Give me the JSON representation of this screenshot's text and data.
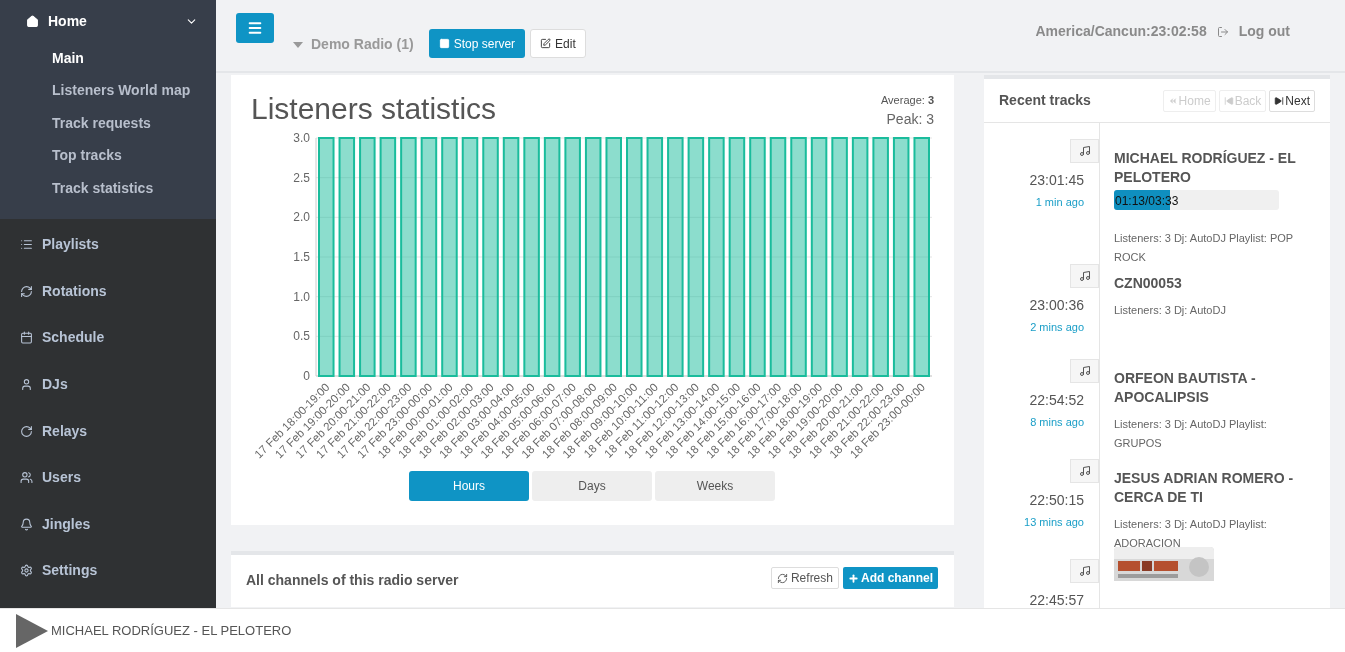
{
  "sidebar": {
    "home": {
      "label": "Home",
      "expanded": true,
      "children": [
        {
          "label": "Main",
          "selected": true
        },
        {
          "label": "Listeners World map",
          "selected": false
        },
        {
          "label": "Track requests",
          "selected": false
        },
        {
          "label": "Top tracks",
          "selected": false
        },
        {
          "label": "Track statistics",
          "selected": false
        }
      ]
    },
    "items": [
      {
        "label": "Playlists"
      },
      {
        "label": "Rotations"
      },
      {
        "label": "Schedule"
      },
      {
        "label": "DJs"
      },
      {
        "label": "Relays"
      },
      {
        "label": "Users"
      },
      {
        "label": "Jingles"
      },
      {
        "label": "Settings"
      }
    ]
  },
  "topbar": {
    "server": "Demo Radio (1)",
    "stop_button": "Stop server",
    "edit_button": "Edit",
    "clock": "America/Cancun:23:02:58",
    "logout": "Log out"
  },
  "stats": {
    "title": "Listeners statistics",
    "average_label": "Average:",
    "average": "3",
    "peak": "Peak: 3",
    "chart_data": {
      "type": "bar",
      "categories": [
        "17 Feb 18:00-19:00",
        "17 Feb 19:00-20:00",
        "17 Feb 20:00-21:00",
        "17 Feb 21:00-22:00",
        "17 Feb 22:00-23:00",
        "17 Feb 23:00-00:00",
        "18 Feb 00:00-01:00",
        "18 Feb 01:00-02:00",
        "18 Feb 02:00-03:00",
        "18 Feb 03:00-04:00",
        "18 Feb 04:00-05:00",
        "18 Feb 05:00-06:00",
        "18 Feb 06:00-07:00",
        "18 Feb 07:00-08:00",
        "18 Feb 08:00-09:00",
        "18 Feb 09:00-10:00",
        "18 Feb 10:00-11:00",
        "18 Feb 11:00-12:00",
        "18 Feb 12:00-13:00",
        "18 Feb 13:00-14:00",
        "18 Feb 14:00-15:00",
        "18 Feb 15:00-16:00",
        "18 Feb 16:00-17:00",
        "18 Feb 17:00-18:00",
        "18 Feb 18:00-19:00",
        "18 Feb 19:00-20:00",
        "18 Feb 20:00-21:00",
        "18 Feb 21:00-22:00",
        "18 Feb 22:00-23:00",
        "18 Feb 23:00-00:00"
      ],
      "grid": true,
      "series": [
        {
          "color": "#1abc9c",
          "values": [
            3,
            3,
            3,
            3,
            3,
            3,
            3,
            3,
            3,
            3,
            3,
            3,
            3,
            3,
            3,
            3,
            3,
            3,
            3,
            3,
            3,
            3,
            3,
            3,
            3,
            3,
            3,
            3,
            3,
            3
          ]
        }
      ],
      "ylim": [
        0,
        3
      ],
      "yticks": [
        {
          "value": 0,
          "label": "0"
        },
        {
          "value": 0.5,
          "label": "0.5"
        },
        {
          "value": 1,
          "label": "1.0"
        },
        {
          "value": 1.5,
          "label": "1.5"
        },
        {
          "value": 2,
          "label": "2.0"
        },
        {
          "value": 2.5,
          "label": "2.5"
        },
        {
          "value": 3,
          "label": "3.0"
        }
      ]
    },
    "periods": [
      {
        "label": "Hours",
        "selected": true
      },
      {
        "label": "Days",
        "selected": false
      },
      {
        "label": "Weeks",
        "selected": false
      }
    ]
  },
  "channels": {
    "title": "All channels of this radio server",
    "refresh": "Refresh",
    "add": "Add channel"
  },
  "recent": {
    "title": "Recent tracks",
    "nav": [
      {
        "label": "Home",
        "disabled": true
      },
      {
        "label": "Back",
        "disabled": true
      },
      {
        "label": "Next",
        "disabled": false
      }
    ],
    "tracks": [
      {
        "time": "23:01:45",
        "ago": "1 min ago",
        "title": "MICHAEL RODRÍGUEZ - EL PELOTERO",
        "progress": {
          "text": "01:13/03:33",
          "level": 0.34
        },
        "meta": "Listeners: 3 Dj: AutoDJ Playlist: POP ROCK"
      },
      {
        "time": "23:00:36",
        "ago": "2 mins ago",
        "title": "CZN00053",
        "meta": "Listeners: 3 Dj: AutoDJ"
      },
      {
        "time": "22:54:52",
        "ago": "8 mins ago",
        "title": "ORFEON BAUTISTA - APOCALIPSIS",
        "meta": "Listeners: 3 Dj: AutoDJ Playlist: GRUPOS"
      },
      {
        "time": "22:50:15",
        "ago": "13 mins ago",
        "title": "JESUS ADRIAN ROMERO - CERCA DE TI",
        "meta": "Listeners: 3 Dj: AutoDJ Playlist: ADORACION"
      },
      {
        "time": "22:45:57"
      }
    ]
  },
  "player": {
    "now_playing": "MICHAEL RODRÍGUEZ - EL PELOTERO"
  }
}
